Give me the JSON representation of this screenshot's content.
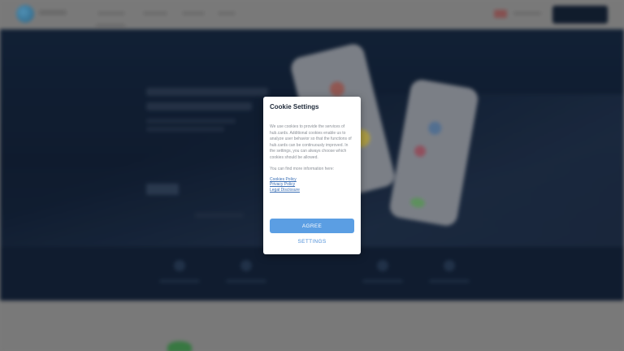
{
  "cookie_modal": {
    "title": "Cookie Settings",
    "body": "We use cookies to provide the services of hub.cards. Additional cookies enable us to analyze user behavior so that the functions of hub.cards can be continuously improved. In the settings, you can always choose which cookies should be allowed.",
    "more_info": "You can find more information here:",
    "links": [
      "Cookies Policy",
      "Privacy Policy",
      "Legal Disclosure"
    ],
    "agree_label": "AGREE",
    "settings_label": "SETTINGS"
  },
  "colors": {
    "primary_button": "#5b9ee3",
    "link": "#3a6fb5",
    "hero_background": "#0d1f38"
  },
  "background_page": {
    "logo_icon": "hub-cards-logo-icon"
  }
}
